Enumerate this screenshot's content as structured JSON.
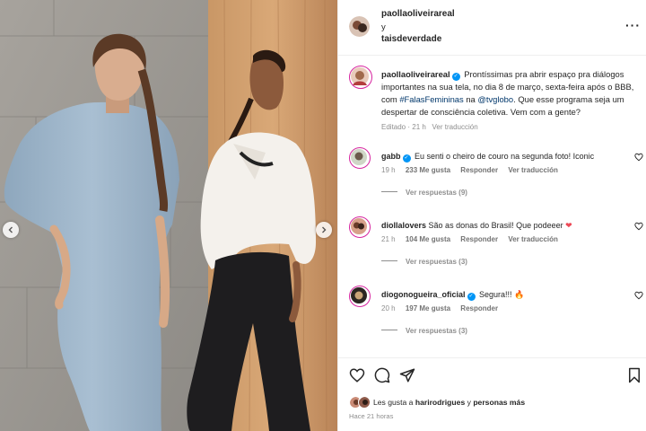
{
  "post": {
    "header": {
      "user1": "paollaoliveirareal",
      "connector": "y",
      "user2": "taisdeverdade",
      "more_icon": "more-horizontal-icon"
    },
    "caption": {
      "username": "paollaoliveirareal",
      "text_before_hashtag": "Prontíssimas pra abrir espaço pra diálogos importantes na sua tela, no dia 8 de março, sexta-feira após o BBB, com ",
      "hashtag": "#FalasFemininas",
      "text_middle": " na ",
      "mention": "@tvglobo",
      "text_after": ". Que esse programa seja um despertar de consciência coletiva. Vem com a gente?",
      "edited": "Editado",
      "separator": "·",
      "time": "21 h",
      "translate": "Ver traducción"
    },
    "comments": [
      {
        "username": "gabb",
        "verified": true,
        "text": "Eu senti o cheiro de couro na segunda foto! Iconic",
        "time": "19 h",
        "likes": "233 Me gusta",
        "reply": "Responder",
        "translate": "Ver traducción",
        "replies": "Ver respuestas (9)"
      },
      {
        "username": "diollalovers",
        "verified": false,
        "text": "São as donas do Brasil! Que podeeer",
        "emoji": "❤",
        "time": "21 h",
        "likes": "104 Me gusta",
        "reply": "Responder",
        "translate": "Ver traducción",
        "replies": "Ver respuestas (3)"
      },
      {
        "username": "diogonogueira_oficial",
        "verified": true,
        "text": "Segura!!!",
        "emoji": "🔥",
        "time": "20 h",
        "likes": "197 Me gusta",
        "reply": "Responder",
        "replies": "Ver respuestas (3)"
      }
    ],
    "actions": {
      "like_icon": "heart-icon",
      "comment_icon": "comment-icon",
      "share_icon": "send-icon",
      "save_icon": "bookmark-icon"
    },
    "likes": {
      "prefix": "Les gusta a",
      "user": "harirodrigues",
      "suffix": "y",
      "others": "personas más"
    },
    "time_ago": "Hace 21 horas",
    "colors": {
      "text": "#262626",
      "secondary": "#8e8e8e",
      "link": "#00376b",
      "verified": "#0095f6",
      "story_ring": "#d6249f",
      "heart": "#ed4956"
    }
  }
}
